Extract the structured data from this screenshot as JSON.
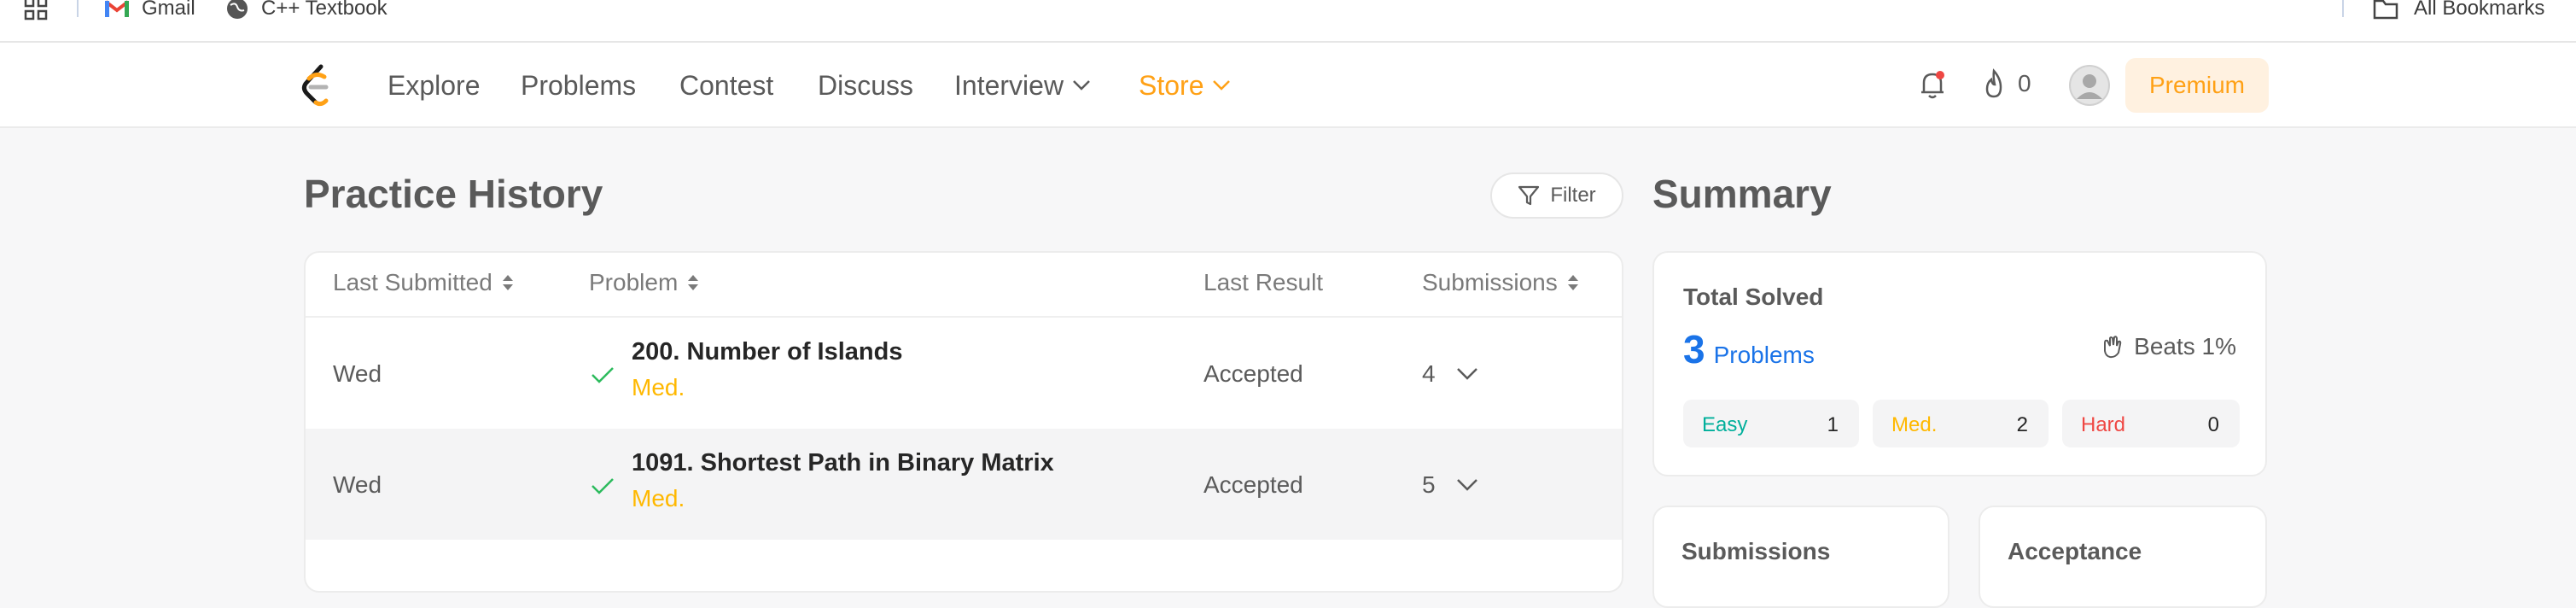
{
  "bookmarks": {
    "items": [
      {
        "label": "Gmail",
        "icon": "gmail-icon"
      },
      {
        "label": "C++ Textbook",
        "icon": "globe-icon"
      }
    ],
    "all_bookmarks_label": "All Bookmarks"
  },
  "nav": {
    "links": [
      "Explore",
      "Problems",
      "Contest",
      "Discuss"
    ],
    "interview_label": "Interview",
    "store_label": "Store",
    "streak_count": "0",
    "premium_label": "Premium"
  },
  "history": {
    "title": "Practice History",
    "filter_label": "Filter",
    "columns": {
      "last_submitted": "Last Submitted",
      "problem": "Problem",
      "last_result": "Last Result",
      "submissions": "Submissions"
    },
    "rows": [
      {
        "day": "Wed",
        "title": "200. Number of Islands",
        "difficulty": "Med.",
        "result": "Accepted",
        "submissions": "4"
      },
      {
        "day": "Wed",
        "title": "1091. Shortest Path in Binary Matrix",
        "difficulty": "Med.",
        "result": "Accepted",
        "submissions": "5"
      }
    ]
  },
  "summary": {
    "title": "Summary",
    "total_solved_label": "Total Solved",
    "solved_count": "3",
    "problems_label": "Problems",
    "beats_label": "Beats 1%",
    "difficulty": [
      {
        "label": "Easy",
        "count": "1",
        "color": "#00af9b"
      },
      {
        "label": "Med.",
        "count": "2",
        "color": "#ffb800"
      },
      {
        "label": "Hard",
        "count": "0",
        "color": "#ef4743"
      }
    ],
    "submissions_label": "Submissions",
    "acceptance_label": "Acceptance"
  },
  "colors": {
    "accent": "#ffa116",
    "blue": "#1a73e8",
    "check": "#2cbb5d"
  }
}
